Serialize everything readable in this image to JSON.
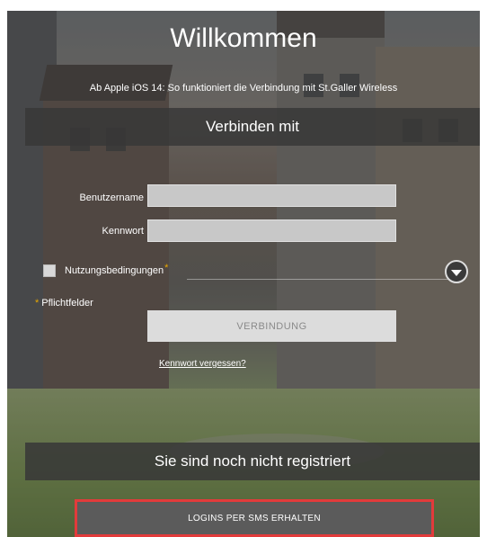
{
  "header": {
    "title": "Willkommen",
    "subtitle": "Ab Apple iOS 14: So funktioniert die Verbindung mit St.Galler Wireless"
  },
  "connect_section": {
    "heading": "Verbinden mit"
  },
  "form": {
    "username_label": "Benutzername",
    "username_value": "",
    "password_label": "Kennwort",
    "password_value": "",
    "terms_label": "Nutzungsbedingungen",
    "terms_required_mark": "*",
    "terms_checked": false,
    "required_note_mark": "*",
    "required_note": "Pflichtfelder",
    "connect_button": "VERBINDUNG",
    "forgot_link": "Kennwort vergessen?"
  },
  "register_section": {
    "heading": "Sie sind noch nicht registriert",
    "sms_button": "LOGINS PER SMS ERHALTEN"
  },
  "colors": {
    "accent_required": "#e8a800",
    "highlight_border": "#e23b3b",
    "band_background": "#373737"
  },
  "icons": {
    "dropdown": "chevron-down-icon",
    "checkbox": "checkbox-icon"
  }
}
